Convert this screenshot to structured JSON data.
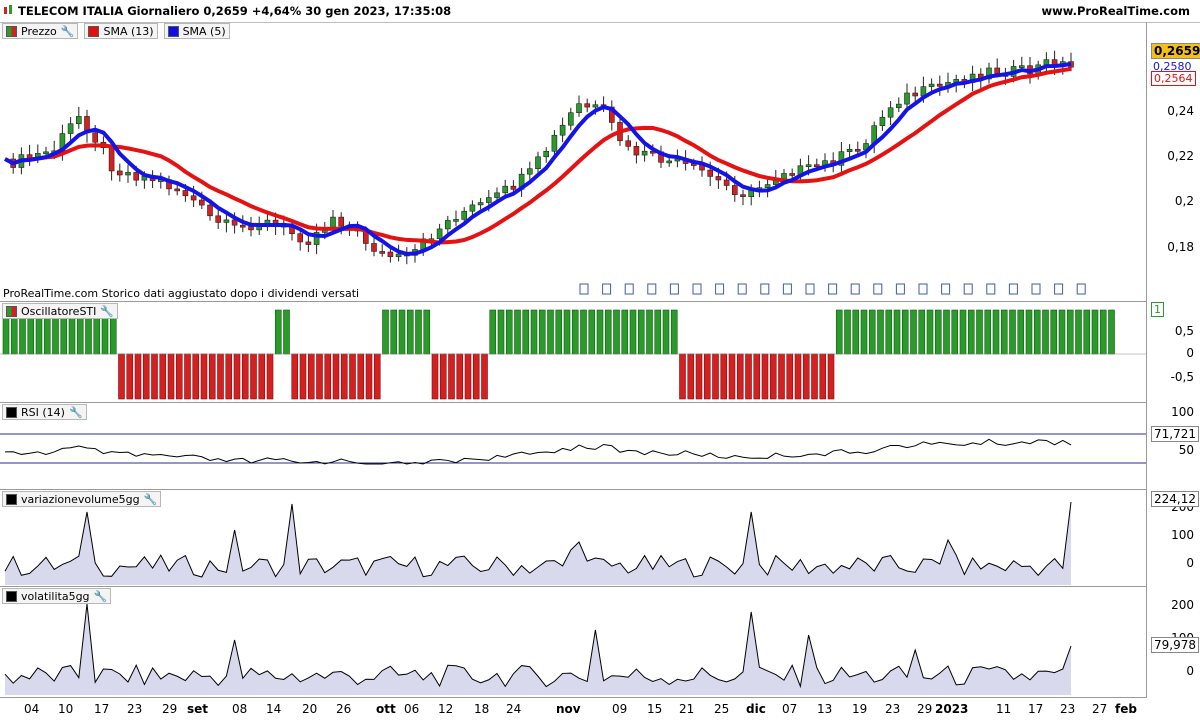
{
  "header": {
    "title": "TELECOM ITALIA Giornaliero 0,2659 +4,64% 30 gen 2023, 17:35:08",
    "site": "www.ProRealTime.com",
    "logo_icon": "candlestick-logo-icon"
  },
  "price_panel": {
    "legend": [
      {
        "label": "Prezzo",
        "color": "#2a9a2a"
      },
      {
        "label": "SMA (13)",
        "color": "#e01010"
      },
      {
        "label": "SMA (5)",
        "color": "#1010e0"
      }
    ],
    "note": "ProRealTime.com  Storico dati aggiustato dopo i dividendi versati",
    "y_ticks": [
      "0,24",
      "0,22",
      "0,2",
      "0,18"
    ],
    "last_price": "0,2659",
    "sma5_value": "0,2580",
    "sma13_value": "0,2564",
    "colors": {
      "up": "#2a9a2a",
      "down": "#d42020",
      "sma13": "#e51212",
      "sma5": "#1414e6",
      "last_price_bg": "#f2c018"
    }
  },
  "sti_panel": {
    "legend": "OscillatoreSTI",
    "y_ticks": [
      "1",
      "0,5",
      "0",
      "-0,5"
    ],
    "last_value": "1"
  },
  "rsi_panel": {
    "legend": "RSI (14)",
    "y_ticks": [
      "100",
      "50"
    ],
    "last_value": "71,721"
  },
  "vol_panel": {
    "legend": "variazionevolume5gg",
    "y_ticks": [
      "200",
      "100",
      "0"
    ],
    "last_value": "224,12"
  },
  "volat_panel": {
    "legend": "volatilita5gg",
    "y_ticks": [
      "200",
      "100",
      "0"
    ],
    "last_value": "79,978"
  },
  "x_axis": {
    "ticks": [
      {
        "label": "04",
        "bold": false
      },
      {
        "label": "10",
        "bold": false
      },
      {
        "label": "17",
        "bold": false
      },
      {
        "label": "23",
        "bold": false
      },
      {
        "label": "29",
        "bold": false
      },
      {
        "label": "set",
        "bold": true
      },
      {
        "label": "08",
        "bold": false
      },
      {
        "label": "14",
        "bold": false
      },
      {
        "label": "20",
        "bold": false
      },
      {
        "label": "26",
        "bold": false
      },
      {
        "label": "ott",
        "bold": true
      },
      {
        "label": "06",
        "bold": false
      },
      {
        "label": "12",
        "bold": false
      },
      {
        "label": "18",
        "bold": false
      },
      {
        "label": "24",
        "bold": false
      },
      {
        "label": "nov",
        "bold": true
      },
      {
        "label": "09",
        "bold": false
      },
      {
        "label": "15",
        "bold": false
      },
      {
        "label": "21",
        "bold": false
      },
      {
        "label": "25",
        "bold": false
      },
      {
        "label": "dic",
        "bold": true
      },
      {
        "label": "07",
        "bold": false
      },
      {
        "label": "13",
        "bold": false
      },
      {
        "label": "19",
        "bold": false
      },
      {
        "label": "23",
        "bold": false
      },
      {
        "label": "29",
        "bold": false
      },
      {
        "label": "2023",
        "bold": true
      },
      {
        "label": "11",
        "bold": false
      },
      {
        "label": "17",
        "bold": false
      },
      {
        "label": "23",
        "bold": false
      },
      {
        "label": "27",
        "bold": false
      },
      {
        "label": "feb",
        "bold": true
      }
    ]
  }
}
